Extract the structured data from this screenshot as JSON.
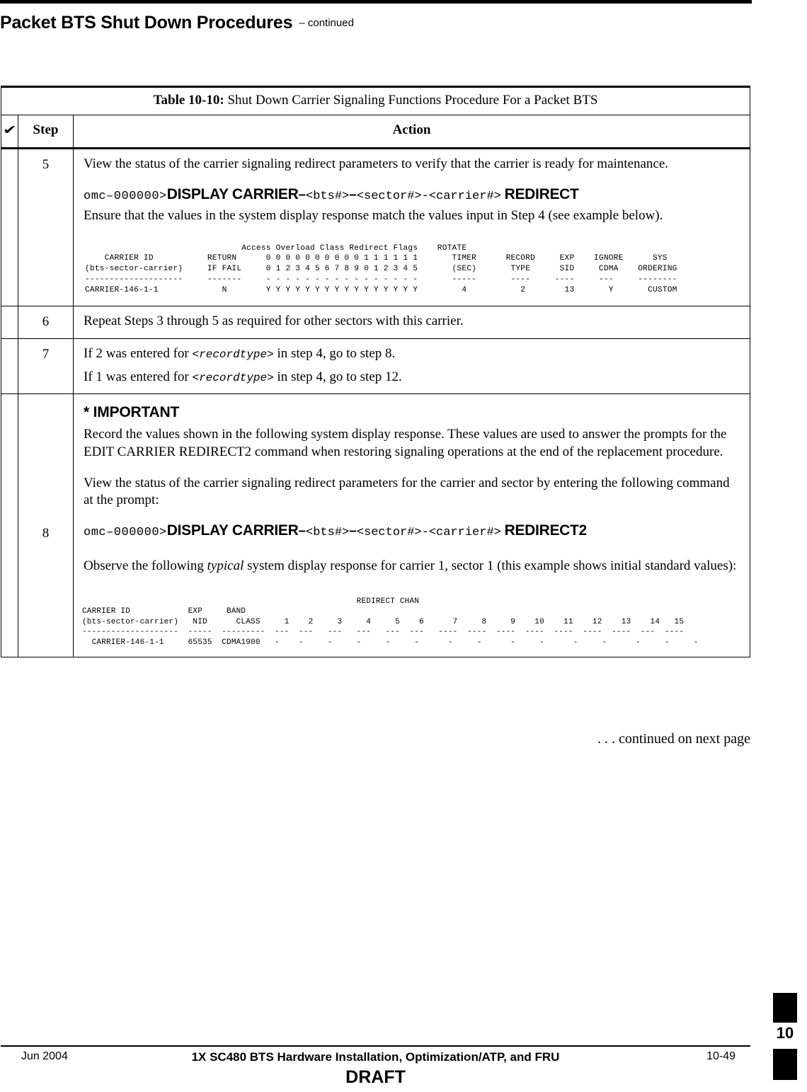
{
  "running_head": {
    "title": "Packet BTS Shut Down Procedures",
    "continued": "– continued"
  },
  "table": {
    "caption_label": "Table 10-10:",
    "caption_text": " Shut Down Carrier Signaling Functions Procedure For a Packet BTS",
    "headers": {
      "check_icon": "✔",
      "step": "Step",
      "action": "Action"
    },
    "rows": [
      {
        "step": "5",
        "para1": "View the status of the carrier signaling redirect parameters to verify that the carrier is ready for maintenance.",
        "cli": {
          "prompt": "omc–000000>",
          "command": "DISPLAY CARRIER",
          "dash1": "–",
          "arg1": "<bts#>",
          "dash2": "–",
          "arg2": "<sector#>-<carrier#>",
          "suffix": "REDIRECT"
        },
        "para2": "Ensure that the values in the system display response match the values input in Step 4 (see example below).",
        "response": "                                Access Overload Class Redirect Flags    ROTATE\n    CARRIER ID           RETURN      0 0 0 0 0 0 0 0 0 0 1 1 1 1 1 1       TIMER      RECORD     EXP    IGNORE      SYS\n(bts-sector-carrier)     IF FAIL     0 1 2 3 4 5 6 7 8 9 0 1 2 3 4 5       (SEC)       TYPE      SID     CDMA    ORDERING\n--------------------     -------     - - - - - - - - - - - - - - - -       -----       ----     ----     ---     --------\nCARRIER-146-1-1             N        Y Y Y Y Y Y Y Y Y Y Y Y Y Y Y Y         4           2        13       Y       CUSTOM"
      },
      {
        "step": "6",
        "para1": "Repeat Steps 3 through 5 as required for other sectors with this carrier."
      },
      {
        "step": "7",
        "line1_a": "If 2 was entered for ",
        "line1_mono": "<recordtype>",
        "line1_b": " in step 4, go to step 8.",
        "line2_a": "If 1 was entered for ",
        "line2_mono": "<recordtype>",
        "line2_b": " in step 4, go to step 12."
      },
      {
        "step": "8",
        "important_header": "* IMPORTANT",
        "important_body": "Record the values shown in the following system display response. These values are used to answer the prompts for the EDIT CARRIER REDIRECT2 command when restoring signaling operations at the end of the replacement procedure.",
        "para1": "View the status of the carrier signaling redirect parameters for the carrier and sector by entering the following command at the prompt:",
        "cli": {
          "prompt": "omc–000000>",
          "command": "DISPLAY CARRIER",
          "dash1": "–",
          "arg1": "<bts#>",
          "dash2": "–",
          "arg2": "<sector#>-<carrier#>",
          "suffix": "REDIRECT2"
        },
        "para2_a": "Observe the following ",
        "para2_ital": "typical",
        "para2_b": " system display response for carrier 1, sector 1 (this example shows initial standard values):",
        "response": "                                                         REDIRECT CHAN\nCARRIER ID            EXP     BAND\n(bts-sector-carrier)   NID      CLASS     1    2     3     4     5    6      7     8     9    10    11    12    13    14   15\n--------------------  -----  ---------  ---  ---   ---   ---   ---  ---   ----  ----  ----  ----  ----  ----  ----  ---  ----\n  CARRIER-146-1-1     65535  CDMA1900   -    -     -     -     -     -      -     -      -     -      -     -      -     -     -"
      }
    ]
  },
  "continued_note": ". . . continued on next page",
  "footer": {
    "date": "Jun 2004",
    "title": "1X SC480 BTS Hardware Installation, Optimization/ATP, and FRU",
    "page": "10-49",
    "draft": "DRAFT",
    "chapter_tab": "10"
  },
  "chart_data": {
    "type": "table",
    "title": "Carrier Redirect Parameters — system display response (Step 5)",
    "columns": [
      "CARRIER ID (bts-sector-carrier)",
      "RETURN IF FAIL",
      "Access Overload Class Redirect Flags 00-15",
      "ROTATE TIMER (SEC)",
      "RECORD TYPE",
      "EXP SID",
      "IGNORE CDMA",
      "SYS ORDERING"
    ],
    "rows": [
      [
        "CARRIER-146-1-1",
        "N",
        "Y Y Y Y Y Y Y Y Y Y Y Y Y Y Y Y",
        "4",
        "2",
        "13",
        "Y",
        "CUSTOM"
      ]
    ],
    "second_table": {
      "title": "Carrier Redirect2 Parameters — system display response (Step 8)",
      "columns": [
        "CARRIER ID (bts-sector-carrier)",
        "EXP NID",
        "BAND CLASS",
        "REDIRECT CHAN 1",
        "2",
        "3",
        "4",
        "5",
        "6",
        "7",
        "8",
        "9",
        "10",
        "11",
        "12",
        "13",
        "14",
        "15"
      ],
      "rows": [
        [
          "CARRIER-146-1-1",
          "65535",
          "CDMA1900",
          "-",
          "-",
          "-",
          "-",
          "-",
          "-",
          "-",
          "-",
          "-",
          "-",
          "-",
          "-",
          "-",
          "-",
          "-"
        ]
      ]
    }
  }
}
